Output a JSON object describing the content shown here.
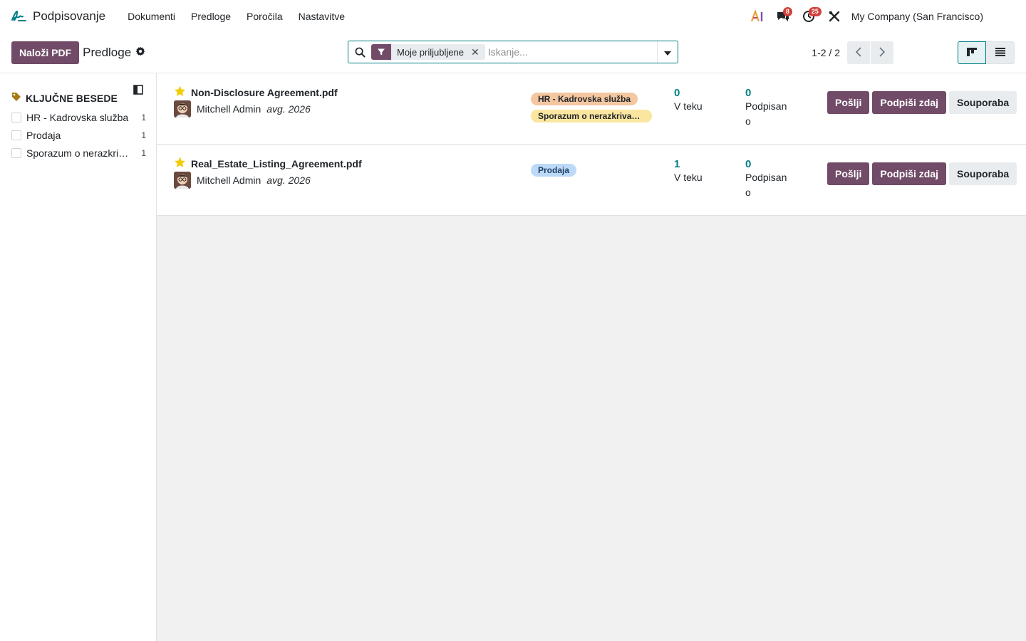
{
  "colors": {
    "brand": "#714b67",
    "accent": "#017e84",
    "badge": "#d23f3a"
  },
  "app": {
    "title": "Podpisovanje",
    "icon": "sign-logo-icon"
  },
  "menu": [
    "Dokumenti",
    "Predloge",
    "Poročila",
    "Nastavitve"
  ],
  "systray": {
    "ai_icon": "ai-icon",
    "messages_badge": "8",
    "activities_badge": "25",
    "tools_icon": "tools-icon",
    "company": "My Company (San Francisco)"
  },
  "control": {
    "upload_label": "Naloži PDF",
    "breadcrumb": "Predloge",
    "facet": "Moje priljubljene",
    "search_placeholder": "Iskanje...",
    "pager": "1-2 / 2"
  },
  "sidebar": {
    "title": "KLJUČNE BESEDE",
    "items": [
      {
        "label": "HR - Kadrovska služba",
        "count": "1"
      },
      {
        "label": "Prodaja",
        "count": "1"
      },
      {
        "label": "Sporazum o nerazkrivanju informacij",
        "count": "1"
      }
    ]
  },
  "records": [
    {
      "title": "Non-Disclosure Agreement.pdf",
      "favorite": true,
      "owner": "Mitchell Admin",
      "date": "avg. 2026",
      "tags": [
        {
          "label": "HR - Kadrovska služba",
          "color": "#f4c7a1"
        },
        {
          "label": "Sporazum o nerazkrivanju informacij",
          "color": "#fbe6a0"
        }
      ],
      "in_progress": "0",
      "in_progress_label": "V teku",
      "signed": "0",
      "signed_label": "Podpisano",
      "send_label": "Pošlji",
      "sign_now_label": "Podpiši zdaj",
      "usage_label": "Souporaba"
    },
    {
      "title": "Real_Estate_Listing_Agreement.pdf",
      "favorite": true,
      "owner": "Mitchell Admin",
      "date": "avg. 2026",
      "tags": [
        {
          "label": "Prodaja",
          "color": "#bcd9f7"
        }
      ],
      "in_progress": "1",
      "in_progress_label": "V teku",
      "signed": "0",
      "signed_label": "Podpisano",
      "send_label": "Pošlji",
      "sign_now_label": "Podpiši zdaj",
      "usage_label": "Souporaba"
    }
  ]
}
